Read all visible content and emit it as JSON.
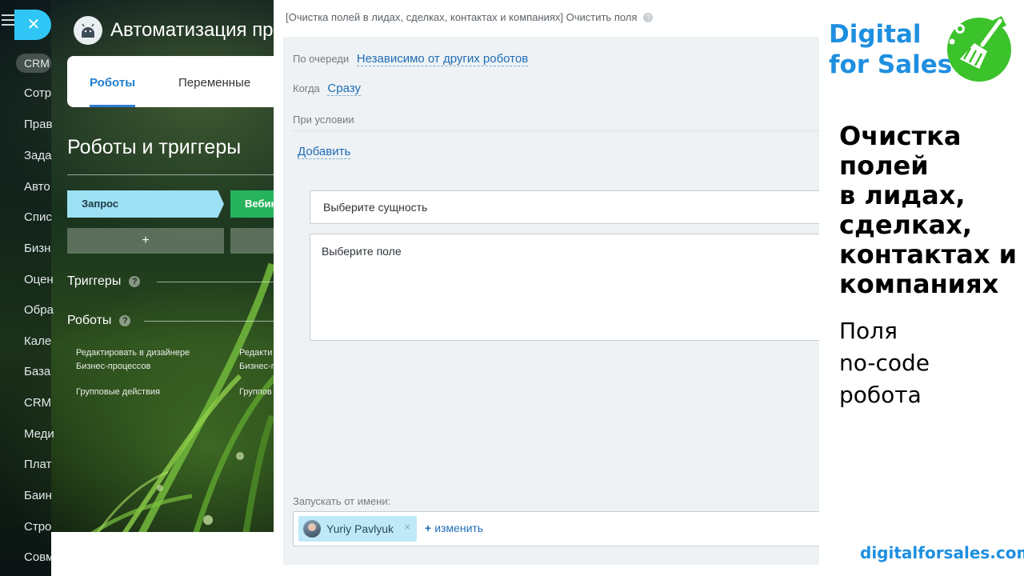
{
  "sidebar": {
    "items": [
      "CRM",
      "Сотр",
      "Прав",
      "Зада",
      "Авто",
      "Спис",
      "Бизн",
      "Оцен",
      "Обра",
      "Кале",
      "База",
      "CRM",
      "Меди",
      "Плат",
      "Баин",
      "Стро",
      "Совм"
    ]
  },
  "automation": {
    "title": "Автоматизация пр",
    "tabs": [
      "Роботы",
      "Переменные"
    ],
    "section_title": "Роботы и триггеры",
    "stages": [
      "Запрос",
      "Вебин"
    ],
    "add_stage_symbol": "+",
    "triggers_label": "Триггеры",
    "robots_label": "Роботы",
    "help_symbol": "?",
    "links": {
      "edit_designer": "Редактировать в дизайнере Бизнес-процессов",
      "edit_designer_cut": "Редакти Бизнес-п",
      "group_actions": "Групповые действия",
      "group_actions_cut": "Группов"
    }
  },
  "robot_panel": {
    "title": "[Очистка полей в лидах, сделках, контактах и компаниях] Очистить поля",
    "queue_label": "По очереди",
    "queue_value": "Независимо от других роботов",
    "when_label": "Когда",
    "when_value": "Сразу",
    "condition_label": "При условии",
    "add_link": "Добавить",
    "entity_select": "Выберите сущность",
    "field_select": "Выберите поле",
    "run_as_label": "Запускать от имени:",
    "user_name": "Yuriy Pavlyuk",
    "remove_symbol": "×",
    "change_link": "изменить",
    "change_symbol": "+"
  },
  "branding": {
    "line1": "Digital",
    "line2": "for Sales",
    "headline": [
      "Очистка",
      "полей",
      "в лидах,",
      "сделках,",
      "контактах и",
      "компаниях"
    ],
    "subline": [
      "Поля",
      "no-code",
      "робота"
    ],
    "site": "digitalforsales.com",
    "accent_color": "#1e8fe0",
    "logo_color": "#3cc22a"
  }
}
